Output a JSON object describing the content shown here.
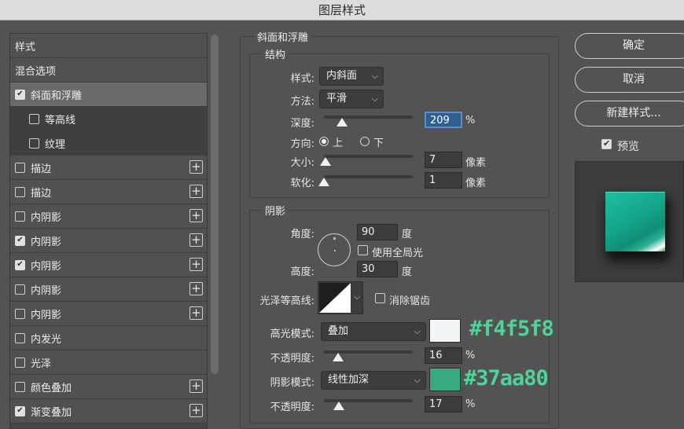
{
  "window": {
    "title": "图层样式"
  },
  "styles_list": [
    {
      "label": "样式",
      "checkbox": false,
      "checked": false,
      "plus": false,
      "state": "header"
    },
    {
      "label": "混合选项",
      "checkbox": false,
      "checked": false,
      "plus": false,
      "state": "header"
    },
    {
      "label": "斜面和浮雕",
      "checkbox": true,
      "checked": true,
      "plus": false,
      "state": "selected"
    },
    {
      "label": "等高线",
      "checkbox": true,
      "checked": false,
      "plus": false,
      "state": "sub"
    },
    {
      "label": "纹理",
      "checkbox": true,
      "checked": false,
      "plus": false,
      "state": "sub"
    },
    {
      "label": "描边",
      "checkbox": true,
      "checked": false,
      "plus": true,
      "state": "normal"
    },
    {
      "label": "描边",
      "checkbox": true,
      "checked": false,
      "plus": true,
      "state": "normal"
    },
    {
      "label": "内阴影",
      "checkbox": true,
      "checked": false,
      "plus": true,
      "state": "normal"
    },
    {
      "label": "内阴影",
      "checkbox": true,
      "checked": true,
      "plus": true,
      "state": "normal"
    },
    {
      "label": "内阴影",
      "checkbox": true,
      "checked": true,
      "plus": true,
      "state": "normal"
    },
    {
      "label": "内阴影",
      "checkbox": true,
      "checked": false,
      "plus": true,
      "state": "normal"
    },
    {
      "label": "内阴影",
      "checkbox": true,
      "checked": false,
      "plus": true,
      "state": "normal"
    },
    {
      "label": "内发光",
      "checkbox": true,
      "checked": false,
      "plus": false,
      "state": "normal"
    },
    {
      "label": "光泽",
      "checkbox": true,
      "checked": false,
      "plus": false,
      "state": "normal"
    },
    {
      "label": "颜色叠加",
      "checkbox": true,
      "checked": false,
      "plus": true,
      "state": "normal"
    },
    {
      "label": "渐变叠加",
      "checkbox": true,
      "checked": true,
      "plus": true,
      "state": "normal"
    }
  ],
  "bevel": {
    "title": "斜面和浮雕",
    "structure": {
      "title": "结构",
      "style_label": "样式:",
      "style_value": "内斜面",
      "technique_label": "方法:",
      "technique_value": "平滑",
      "depth_label": "深度:",
      "depth_value": "209",
      "depth_unit": "%",
      "depth_level": 0.2,
      "direction_label": "方向:",
      "direction_up": "上",
      "direction_down": "下",
      "direction_selected": "上",
      "size_label": "大小:",
      "size_value": "7",
      "size_unit": "像素",
      "size_level": 0.02,
      "soften_label": "软化:",
      "soften_value": "1",
      "soften_unit": "像素",
      "soften_level": 0.0
    },
    "shading": {
      "title": "阴影",
      "angle_label": "角度:",
      "angle_value": "90",
      "angle_unit": "度",
      "global_light_label": "使用全局光",
      "global_light_checked": false,
      "altitude_label": "高度:",
      "altitude_value": "30",
      "altitude_unit": "度",
      "gloss_contour_label": "光泽等高线:",
      "antialias_label": "消除锯齿",
      "antialias_checked": false,
      "highlight_mode_label": "高光模式:",
      "highlight_mode_value": "叠加",
      "highlight_color": "#f4f5f8",
      "highlight_opacity_label": "不透明度:",
      "highlight_opacity_value": "16",
      "highlight_opacity_unit": "%",
      "highlight_opacity_level": 0.16,
      "shadow_mode_label": "阴影模式:",
      "shadow_mode_value": "线性加深",
      "shadow_color": "#37aa80",
      "shadow_opacity_label": "不透明度:",
      "shadow_opacity_value": "17",
      "shadow_opacity_unit": "%",
      "shadow_opacity_level": 0.17
    }
  },
  "annotations": {
    "highlight_hex": "#f4f5f8",
    "shadow_hex": "#37aa80"
  },
  "actions": {
    "ok": "确定",
    "cancel": "取消",
    "new_style": "新建样式...",
    "preview_label": "预览",
    "preview_checked": true
  },
  "preview": {
    "tile_color": "#14a58a"
  }
}
